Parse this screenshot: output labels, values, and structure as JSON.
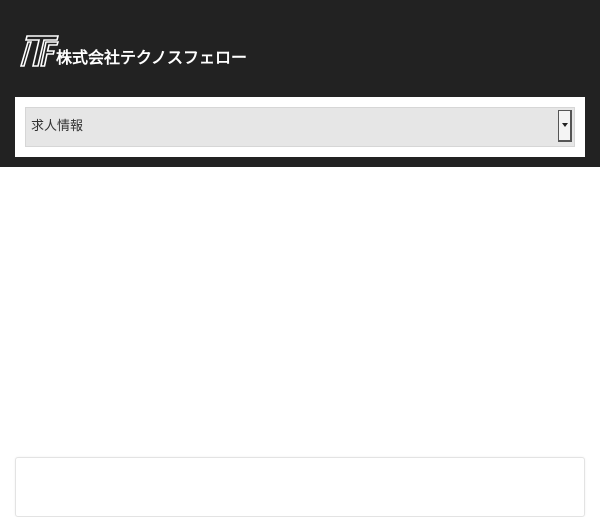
{
  "header": {
    "background": "#222222",
    "logo": {
      "mark_icon": "tf-logo-icon",
      "company_name": "株式会社テクノスフェロー"
    }
  },
  "nav": {
    "select": {
      "selected_label": "求人情報",
      "arrow_icon": "chevron-down-icon"
    }
  }
}
